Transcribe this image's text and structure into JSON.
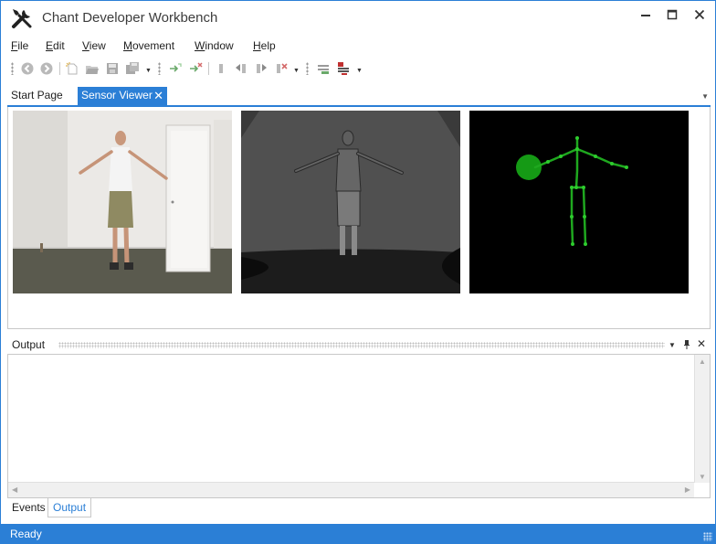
{
  "window": {
    "title": "Chant Developer Workbench"
  },
  "menu": [
    {
      "label": "File"
    },
    {
      "label": "Edit"
    },
    {
      "label": "View"
    },
    {
      "label": "Movement"
    },
    {
      "label": "Window"
    },
    {
      "label": "Help"
    }
  ],
  "toolbar": {
    "icons": [
      "back-icon",
      "forward-icon",
      "new-project-icon",
      "open-project-icon",
      "save-icon",
      "save-all-icon",
      "connect-icon",
      "disconnect-icon",
      "bookmark-icon",
      "step-back-icon",
      "step-forward-icon",
      "clear-icon",
      "record-icon",
      "record-stop-icon"
    ]
  },
  "doc_tabs": [
    {
      "label": "Start Page",
      "active": false
    },
    {
      "label": "Sensor Viewer",
      "active": true
    }
  ],
  "sensor_views": [
    "color-camera-view",
    "depth-camera-view",
    "skeleton-view"
  ],
  "output_panel": {
    "title": "Output"
  },
  "bottom_tabs": [
    {
      "label": "Events",
      "active": false
    },
    {
      "label": "Output",
      "active": true
    }
  ],
  "status": {
    "text": "Ready"
  },
  "colors": {
    "accent": "#2b7fd6",
    "skeleton": "#1fa81f"
  }
}
